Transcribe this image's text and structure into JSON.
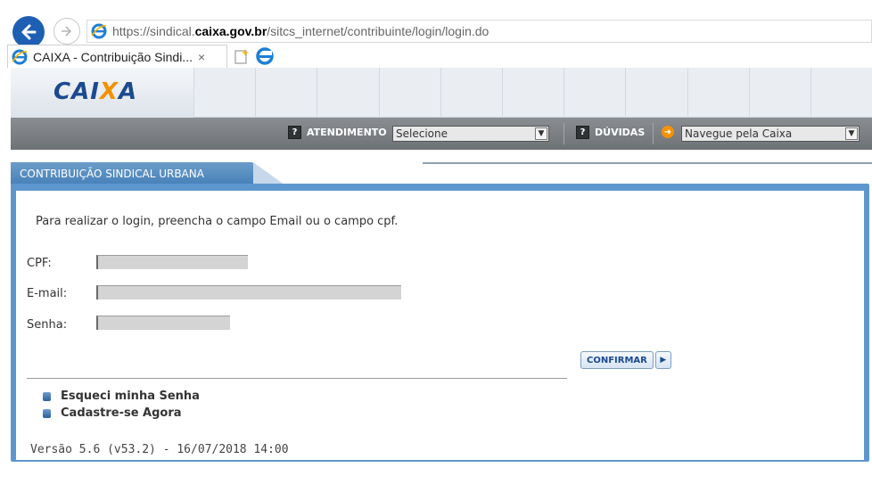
{
  "browser": {
    "url_prefix": "https://sindical.",
    "url_host": "caixa.gov.br",
    "url_path": "/sitcs_internet/contribuinte/login/login.do",
    "tab_title": "CAIXA - Contribuição Sindi...",
    "tab_close": "×"
  },
  "site": {
    "logo_left": "CAI",
    "logo_x": "X",
    "logo_right": "A"
  },
  "topbar": {
    "atendimento_label": "ATENDIMENTO",
    "atendimento_select": "Selecione",
    "duvidas_label": "DÚVIDAS",
    "navegue_select": "Navegue pela Caixa",
    "icon_glyph": "?"
  },
  "section": {
    "tab_title": "CONTRIBUIÇÃO SINDICAL URBANA"
  },
  "form": {
    "intro": "Para realizar o login, preencha o campo Email ou o campo cpf.",
    "cpf_label": "CPF:",
    "email_label": "E-mail:",
    "senha_label": "Senha:",
    "confirm_label": "CONFIRMAR",
    "confirm_arrow": "▶"
  },
  "links": {
    "forgot": "Esqueci minha Senha",
    "register": "Cadastre-se Agora"
  },
  "footer": {
    "version": "Versão 5.6 (v53.2) - 16/07/2018 14:00"
  },
  "colors": {
    "accent_blue": "#1c4a8f",
    "panel_blue": "#5e97cf",
    "orange": "#f39200"
  }
}
